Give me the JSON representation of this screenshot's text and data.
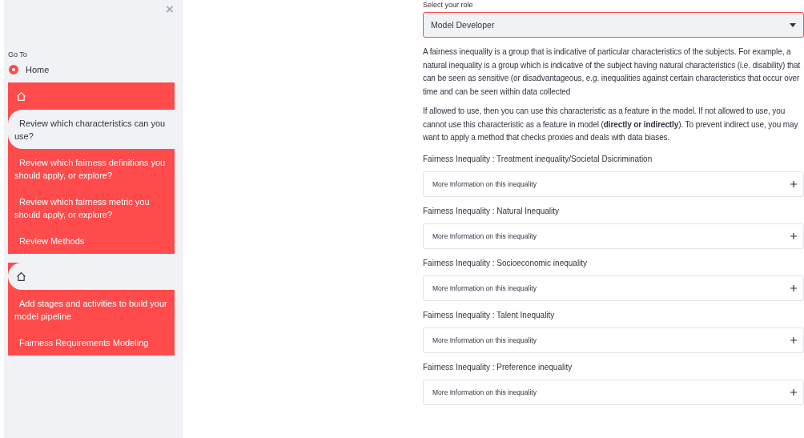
{
  "sidebar": {
    "close_label": "×",
    "goto": {
      "label": "Go To",
      "options": [
        {
          "label": "Home",
          "selected": true
        }
      ]
    },
    "menus": [
      {
        "items": [
          {
            "kind": "icon",
            "selected": false
          },
          {
            "kind": "text",
            "label": "Review which characteristics can you use?",
            "selected": true
          },
          {
            "kind": "text",
            "label": "Review which fairness definitions you should apply, or explore?",
            "selected": false
          },
          {
            "kind": "text",
            "label": "Review which fairness metric you should apply, or explore?",
            "selected": false
          },
          {
            "kind": "text",
            "label": "Review Methods",
            "selected": false
          }
        ]
      },
      {
        "items": [
          {
            "kind": "icon",
            "selected": true
          },
          {
            "kind": "text",
            "label": "Add stages and activities to build your model pipeline",
            "selected": false
          },
          {
            "kind": "text",
            "label": "Fairness Requirements Modeling",
            "selected": false
          }
        ]
      }
    ]
  },
  "main": {
    "role_label": "Select your role",
    "role_value": "Model Developer",
    "paragraphs": [
      "A fairness inequality is a group that is indicative of particular characteristics of the subjects. For example, a natural inequality is a group which is indicative of the subject having natural characteristics (i.e. disability) that can be seen as sensitive (or disadvantageous, e.g. inequalities against certain characteristics that occur over time and can be seen within data collected",
      "If allowed to use, then you can use this characteristic as a feature in the model. If not allowed to use, you cannot use this characteristic as a feature in model (**directly or indirectly**). To prevent indirect use, you may want to apply a method that checks proxies and deals with data biases."
    ],
    "inequalities": [
      {
        "title": "Fairness Inequality : Treatment inequality/Societal Dsicrimination",
        "expander": "More Information on this inequality",
        "expanded": false
      },
      {
        "title": "Fairness Inequality : Natural Inequality",
        "expander": "More Information on this inequality",
        "expanded": false
      },
      {
        "title": "Fairness Inequality : Socioeconomic inequality",
        "expander": "More Information on this inequality",
        "expanded": false
      },
      {
        "title": "Fairness Inequality : Talent Inequality",
        "expander": "More Information on this inequality",
        "expanded": false
      },
      {
        "title": "Fairness Inequality : Preference inequality",
        "expander": "More Information on this inequality",
        "expanded": false
      }
    ]
  }
}
